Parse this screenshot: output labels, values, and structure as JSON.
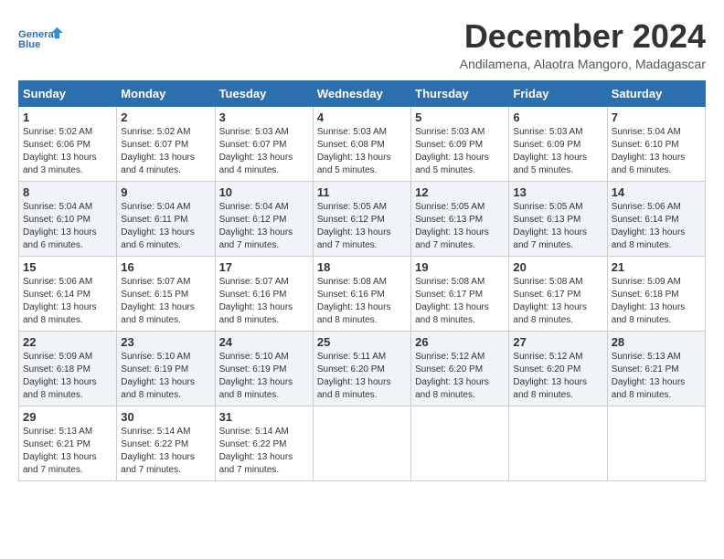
{
  "logo": {
    "line1": "General",
    "line2": "Blue"
  },
  "title": "December 2024",
  "subtitle": "Andilamena, Alaotra Mangoro, Madagascar",
  "days_header": [
    "Sunday",
    "Monday",
    "Tuesday",
    "Wednesday",
    "Thursday",
    "Friday",
    "Saturday"
  ],
  "weeks": [
    [
      {
        "day": "1",
        "sunrise": "Sunrise: 5:02 AM",
        "sunset": "Sunset: 6:06 PM",
        "daylight": "Daylight: 13 hours and 3 minutes."
      },
      {
        "day": "2",
        "sunrise": "Sunrise: 5:02 AM",
        "sunset": "Sunset: 6:07 PM",
        "daylight": "Daylight: 13 hours and 4 minutes."
      },
      {
        "day": "3",
        "sunrise": "Sunrise: 5:03 AM",
        "sunset": "Sunset: 6:07 PM",
        "daylight": "Daylight: 13 hours and 4 minutes."
      },
      {
        "day": "4",
        "sunrise": "Sunrise: 5:03 AM",
        "sunset": "Sunset: 6:08 PM",
        "daylight": "Daylight: 13 hours and 5 minutes."
      },
      {
        "day": "5",
        "sunrise": "Sunrise: 5:03 AM",
        "sunset": "Sunset: 6:09 PM",
        "daylight": "Daylight: 13 hours and 5 minutes."
      },
      {
        "day": "6",
        "sunrise": "Sunrise: 5:03 AM",
        "sunset": "Sunset: 6:09 PM",
        "daylight": "Daylight: 13 hours and 5 minutes."
      },
      {
        "day": "7",
        "sunrise": "Sunrise: 5:04 AM",
        "sunset": "Sunset: 6:10 PM",
        "daylight": "Daylight: 13 hours and 6 minutes."
      }
    ],
    [
      {
        "day": "8",
        "sunrise": "Sunrise: 5:04 AM",
        "sunset": "Sunset: 6:10 PM",
        "daylight": "Daylight: 13 hours and 6 minutes."
      },
      {
        "day": "9",
        "sunrise": "Sunrise: 5:04 AM",
        "sunset": "Sunset: 6:11 PM",
        "daylight": "Daylight: 13 hours and 6 minutes."
      },
      {
        "day": "10",
        "sunrise": "Sunrise: 5:04 AM",
        "sunset": "Sunset: 6:12 PM",
        "daylight": "Daylight: 13 hours and 7 minutes."
      },
      {
        "day": "11",
        "sunrise": "Sunrise: 5:05 AM",
        "sunset": "Sunset: 6:12 PM",
        "daylight": "Daylight: 13 hours and 7 minutes."
      },
      {
        "day": "12",
        "sunrise": "Sunrise: 5:05 AM",
        "sunset": "Sunset: 6:13 PM",
        "daylight": "Daylight: 13 hours and 7 minutes."
      },
      {
        "day": "13",
        "sunrise": "Sunrise: 5:05 AM",
        "sunset": "Sunset: 6:13 PM",
        "daylight": "Daylight: 13 hours and 7 minutes."
      },
      {
        "day": "14",
        "sunrise": "Sunrise: 5:06 AM",
        "sunset": "Sunset: 6:14 PM",
        "daylight": "Daylight: 13 hours and 8 minutes."
      }
    ],
    [
      {
        "day": "15",
        "sunrise": "Sunrise: 5:06 AM",
        "sunset": "Sunset: 6:14 PM",
        "daylight": "Daylight: 13 hours and 8 minutes."
      },
      {
        "day": "16",
        "sunrise": "Sunrise: 5:07 AM",
        "sunset": "Sunset: 6:15 PM",
        "daylight": "Daylight: 13 hours and 8 minutes."
      },
      {
        "day": "17",
        "sunrise": "Sunrise: 5:07 AM",
        "sunset": "Sunset: 6:16 PM",
        "daylight": "Daylight: 13 hours and 8 minutes."
      },
      {
        "day": "18",
        "sunrise": "Sunrise: 5:08 AM",
        "sunset": "Sunset: 6:16 PM",
        "daylight": "Daylight: 13 hours and 8 minutes."
      },
      {
        "day": "19",
        "sunrise": "Sunrise: 5:08 AM",
        "sunset": "Sunset: 6:17 PM",
        "daylight": "Daylight: 13 hours and 8 minutes."
      },
      {
        "day": "20",
        "sunrise": "Sunrise: 5:08 AM",
        "sunset": "Sunset: 6:17 PM",
        "daylight": "Daylight: 13 hours and 8 minutes."
      },
      {
        "day": "21",
        "sunrise": "Sunrise: 5:09 AM",
        "sunset": "Sunset: 6:18 PM",
        "daylight": "Daylight: 13 hours and 8 minutes."
      }
    ],
    [
      {
        "day": "22",
        "sunrise": "Sunrise: 5:09 AM",
        "sunset": "Sunset: 6:18 PM",
        "daylight": "Daylight: 13 hours and 8 minutes."
      },
      {
        "day": "23",
        "sunrise": "Sunrise: 5:10 AM",
        "sunset": "Sunset: 6:19 PM",
        "daylight": "Daylight: 13 hours and 8 minutes."
      },
      {
        "day": "24",
        "sunrise": "Sunrise: 5:10 AM",
        "sunset": "Sunset: 6:19 PM",
        "daylight": "Daylight: 13 hours and 8 minutes."
      },
      {
        "day": "25",
        "sunrise": "Sunrise: 5:11 AM",
        "sunset": "Sunset: 6:20 PM",
        "daylight": "Daylight: 13 hours and 8 minutes."
      },
      {
        "day": "26",
        "sunrise": "Sunrise: 5:12 AM",
        "sunset": "Sunset: 6:20 PM",
        "daylight": "Daylight: 13 hours and 8 minutes."
      },
      {
        "day": "27",
        "sunrise": "Sunrise: 5:12 AM",
        "sunset": "Sunset: 6:20 PM",
        "daylight": "Daylight: 13 hours and 8 minutes."
      },
      {
        "day": "28",
        "sunrise": "Sunrise: 5:13 AM",
        "sunset": "Sunset: 6:21 PM",
        "daylight": "Daylight: 13 hours and 8 minutes."
      }
    ],
    [
      {
        "day": "29",
        "sunrise": "Sunrise: 5:13 AM",
        "sunset": "Sunset: 6:21 PM",
        "daylight": "Daylight: 13 hours and 7 minutes."
      },
      {
        "day": "30",
        "sunrise": "Sunrise: 5:14 AM",
        "sunset": "Sunset: 6:22 PM",
        "daylight": "Daylight: 13 hours and 7 minutes."
      },
      {
        "day": "31",
        "sunrise": "Sunrise: 5:14 AM",
        "sunset": "Sunset: 6:22 PM",
        "daylight": "Daylight: 13 hours and 7 minutes."
      },
      null,
      null,
      null,
      null
    ]
  ]
}
